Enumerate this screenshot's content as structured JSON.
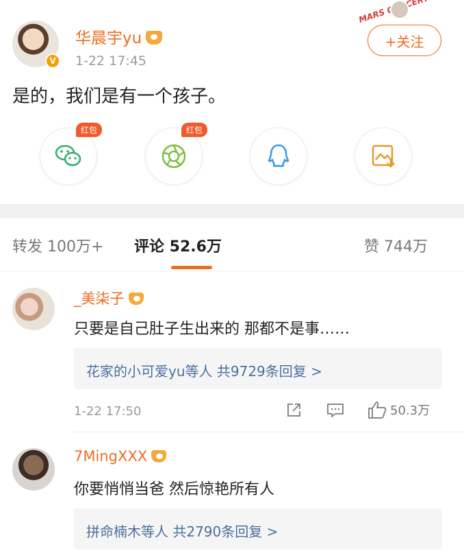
{
  "post": {
    "username": "华晨宇yu",
    "time": "1-22 17:45",
    "follow_label": "+关注",
    "content": "是的，我们是有一个孩子。",
    "deco_tag": "MARS CONCERT",
    "share_items": [
      {
        "icon": "wechat-icon",
        "badge": "红包"
      },
      {
        "icon": "moments-icon",
        "badge": "红包"
      },
      {
        "icon": "qq-icon",
        "badge": ""
      },
      {
        "icon": "save-image-icon",
        "badge": ""
      }
    ]
  },
  "tabs": {
    "repost": "转发 100万+",
    "comments": "评论 52.6万",
    "likes": "赞 744万"
  },
  "comments": [
    {
      "name": "_美柒子",
      "text": "只要是自己肚子生出来的 那都不是事……",
      "replies": "花家的小可爱yu等人  共9729条回复 >",
      "time": "1-22 17:50",
      "likes": "50.3万"
    },
    {
      "name": "7MingXXX",
      "text": "你要悄悄当爸 然后惊艳所有人",
      "replies": "拼命楠木等人  共2790条回复 >"
    }
  ],
  "colors": {
    "accent": "#ec6d23",
    "link": "#4a6fa0",
    "wechat": "#2aae67",
    "moments": "#7bbf3f",
    "qq": "#3a9be0",
    "save": "#e69a2b"
  }
}
